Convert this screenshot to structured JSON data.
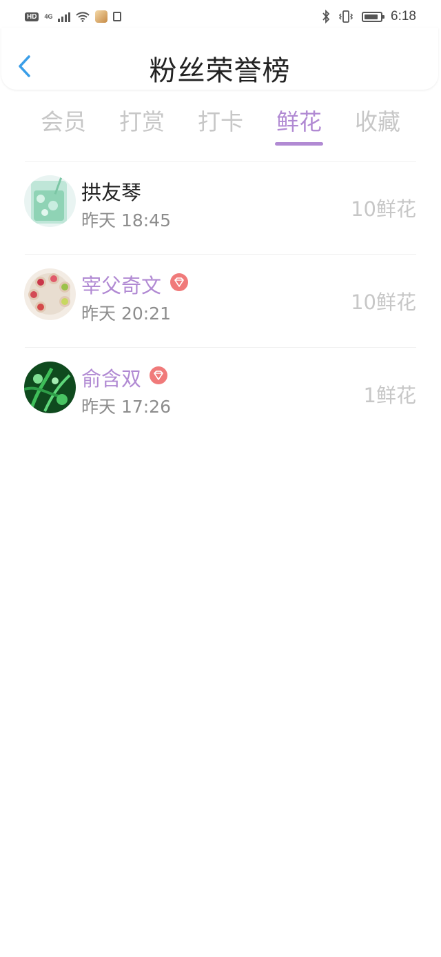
{
  "status_bar": {
    "hd_badge": "HD",
    "network": "4G",
    "time": "6:18",
    "battery_level": 0.85
  },
  "header": {
    "title": "粉丝荣誉榜"
  },
  "tabs": [
    {
      "label": "会员"
    },
    {
      "label": "打赏"
    },
    {
      "label": "打卡"
    },
    {
      "label": "鲜花",
      "active": true
    },
    {
      "label": "收藏"
    }
  ],
  "list": [
    {
      "name": "拱友琴",
      "time": "昨天 18:45",
      "amount": "10鲜花",
      "vip": false,
      "avatar": "green-drink-photo"
    },
    {
      "name": "宰父奇文",
      "time": "昨天 20:21",
      "amount": "10鲜花",
      "vip": true,
      "avatar": "tea-cups-photo"
    },
    {
      "name": "俞含双",
      "time": "昨天 17:26",
      "amount": "1鲜花",
      "vip": true,
      "avatar": "green-plants-photo"
    }
  ],
  "colors": {
    "accent": "#b18ad3",
    "badge": "#f07a7a",
    "muted": "#c7c7c7",
    "back_icon": "#3a9ee8"
  }
}
